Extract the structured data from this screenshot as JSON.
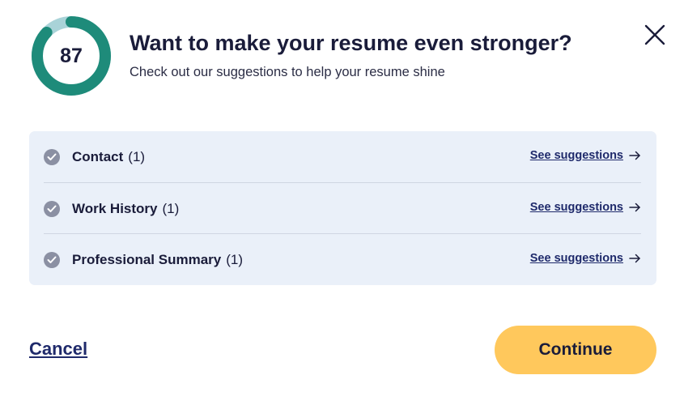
{
  "score": {
    "value": "87",
    "fraction": 0.87,
    "colors": {
      "fill": "#1e8b7a",
      "track": "#a9d3d8"
    }
  },
  "header": {
    "title": "Want to make your resume even stronger?",
    "subtitle": "Check out our suggestions to help your resume shine",
    "close_icon": "close-icon"
  },
  "sections": [
    {
      "label": "Contact",
      "count": "(1)",
      "link_label": "See suggestions",
      "icon": "check-circle-icon"
    },
    {
      "label": "Work History",
      "count": "(1)",
      "link_label": "See suggestions",
      "icon": "check-circle-icon"
    },
    {
      "label": "Professional Summary",
      "count": "(1)",
      "link_label": "See suggestions",
      "icon": "check-circle-icon"
    }
  ],
  "footer": {
    "cancel_label": "Cancel",
    "continue_label": "Continue"
  },
  "colors": {
    "accent_button": "#ffc85c",
    "link": "#1f2a6b",
    "panel_bg": "#eaf0f9",
    "check_bg": "#8b90a3"
  }
}
